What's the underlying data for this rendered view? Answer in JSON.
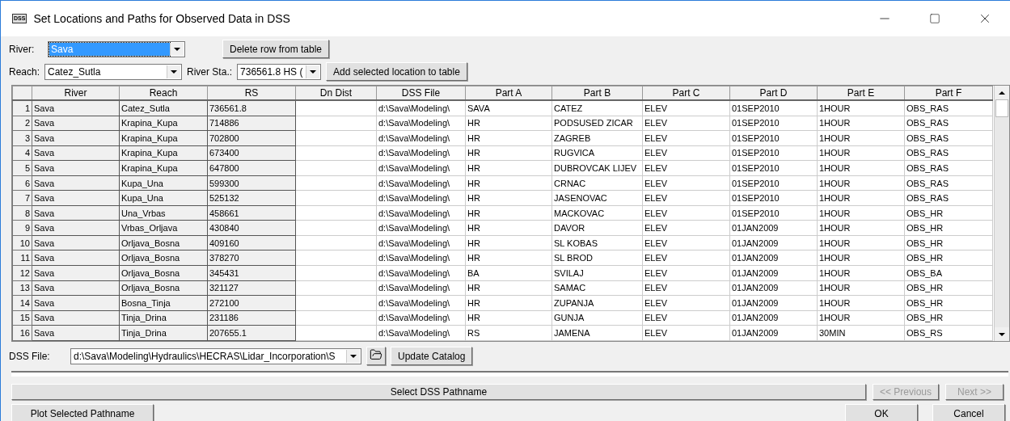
{
  "window": {
    "icon_text": "DSS",
    "title": "Set Locations and Paths for Observed Data in DSS"
  },
  "river": {
    "label": "River:",
    "value": "Sava",
    "focused": true
  },
  "delete_button": "Delete row from table",
  "reach": {
    "label": "Reach:",
    "value": "Catez_Sutla"
  },
  "river_sta": {
    "label": "River Sta.:",
    "value": "736561.8  HS ("
  },
  "add_button": "Add selected location to table",
  "table": {
    "columns": [
      {
        "label": "River",
        "readonly": true
      },
      {
        "label": "Reach",
        "readonly": true
      },
      {
        "label": "RS",
        "readonly": true
      },
      {
        "label": "Dn Dist",
        "readonly": false
      },
      {
        "label": "DSS File",
        "readonly": false
      },
      {
        "label": "Part A",
        "readonly": false
      },
      {
        "label": "Part B",
        "readonly": false
      },
      {
        "label": "Part C",
        "readonly": false
      },
      {
        "label": "Part D",
        "readonly": false
      },
      {
        "label": "Part E",
        "readonly": false
      },
      {
        "label": "Part F",
        "readonly": false
      }
    ],
    "rows": [
      {
        "num": "1",
        "cells": [
          "Sava",
          "Catez_Sutla",
          "736561.8",
          "",
          "d:\\Sava\\Modeling\\",
          "SAVA",
          "CATEZ",
          "ELEV",
          "01SEP2010",
          "1HOUR",
          "OBS_RAS"
        ]
      },
      {
        "num": "2",
        "cells": [
          "Sava",
          "Krapina_Kupa",
          "714886",
          "",
          "d:\\Sava\\Modeling\\",
          "HR",
          "PODSUSED ZICAR",
          "ELEV",
          "01SEP2010",
          "1HOUR",
          "OBS_RAS"
        ]
      },
      {
        "num": "3",
        "cells": [
          "Sava",
          "Krapina_Kupa",
          "702800",
          "",
          "d:\\Sava\\Modeling\\",
          "HR",
          "ZAGREB",
          "ELEV",
          "01SEP2010",
          "1HOUR",
          "OBS_RAS"
        ]
      },
      {
        "num": "4",
        "cells": [
          "Sava",
          "Krapina_Kupa",
          "673400",
          "",
          "d:\\Sava\\Modeling\\",
          "HR",
          "RUGVICA",
          "ELEV",
          "01SEP2010",
          "1HOUR",
          "OBS_RAS"
        ]
      },
      {
        "num": "5",
        "cells": [
          "Sava",
          "Krapina_Kupa",
          "647800",
          "",
          "d:\\Sava\\Modeling\\",
          "HR",
          "DUBROVCAK LIJEV",
          "ELEV",
          "01SEP2010",
          "1HOUR",
          "OBS_RAS"
        ]
      },
      {
        "num": "6",
        "cells": [
          "Sava",
          "Kupa_Una",
          "599300",
          "",
          "d:\\Sava\\Modeling\\",
          "HR",
          "CRNAC",
          "ELEV",
          "01SEP2010",
          "1HOUR",
          "OBS_RAS"
        ]
      },
      {
        "num": "7",
        "cells": [
          "Sava",
          "Kupa_Una",
          "525132",
          "",
          "d:\\Sava\\Modeling\\",
          "HR",
          "JASENOVAC",
          "ELEV",
          "01SEP2010",
          "1HOUR",
          "OBS_RAS"
        ]
      },
      {
        "num": "8",
        "cells": [
          "Sava",
          "Una_Vrbas",
          "458661",
          "",
          "d:\\Sava\\Modeling\\",
          "HR",
          "MACKOVAC",
          "ELEV",
          "01SEP2010",
          "1HOUR",
          "OBS_HR"
        ]
      },
      {
        "num": "9",
        "cells": [
          "Sava",
          "Vrbas_Orljava",
          "430840",
          "",
          "d:\\Sava\\Modeling\\",
          "HR",
          "DAVOR",
          "ELEV",
          "01JAN2009",
          "1HOUR",
          "OBS_HR"
        ]
      },
      {
        "num": "10",
        "cells": [
          "Sava",
          "Orljava_Bosna",
          "409160",
          "",
          "d:\\Sava\\Modeling\\",
          "HR",
          "SL KOBAS",
          "ELEV",
          "01JAN2009",
          "1HOUR",
          "OBS_HR"
        ]
      },
      {
        "num": "11",
        "cells": [
          "Sava",
          "Orljava_Bosna",
          "378270",
          "",
          "d:\\Sava\\Modeling\\",
          "HR",
          "SL BROD",
          "ELEV",
          "01JAN2009",
          "1HOUR",
          "OBS_HR"
        ]
      },
      {
        "num": "12",
        "cells": [
          "Sava",
          "Orljava_Bosna",
          "345431",
          "",
          "d:\\Sava\\Modeling\\",
          "BA",
          "SVILAJ",
          "ELEV",
          "01JAN2009",
          "1HOUR",
          "OBS_BA"
        ]
      },
      {
        "num": "13",
        "cells": [
          "Sava",
          "Orljava_Bosna",
          "321127",
          "",
          "d:\\Sava\\Modeling\\",
          "HR",
          "SAMAC",
          "ELEV",
          "01JAN2009",
          "1HOUR",
          "OBS_HR"
        ]
      },
      {
        "num": "14",
        "cells": [
          "Sava",
          "Bosna_Tinja",
          "272100",
          "",
          "d:\\Sava\\Modeling\\",
          "HR",
          "ZUPANJA",
          "ELEV",
          "01JAN2009",
          "1HOUR",
          "OBS_HR"
        ]
      },
      {
        "num": "15",
        "cells": [
          "Sava",
          "Tinja_Drina",
          "231186",
          "",
          "d:\\Sava\\Modeling\\",
          "HR",
          "GUNJA",
          "ELEV",
          "01JAN2009",
          "1HOUR",
          "OBS_HR"
        ]
      },
      {
        "num": "16",
        "cells": [
          "Sava",
          "Tinja_Drina",
          "207655.1",
          "",
          "d:\\Sava\\Modeling\\",
          "RS",
          "JAMENA",
          "ELEV",
          "01JAN2009",
          "30MIN",
          "OBS_RS"
        ]
      }
    ]
  },
  "dss_file": {
    "label": "DSS File:",
    "value": "d:\\Sava\\Modeling\\Hydraulics\\HECRAS\\Lidar_Incorporation\\S"
  },
  "update_button": "Update Catalog",
  "select_button": "Select DSS Pathname",
  "nav_buttons": [
    {
      "label": "<< Previous",
      "disabled": true
    },
    {
      "label": "Next >>",
      "disabled": true
    }
  ],
  "plot_button": "Plot Selected Pathname",
  "footer_buttons": [
    "OK",
    "Cancel"
  ]
}
